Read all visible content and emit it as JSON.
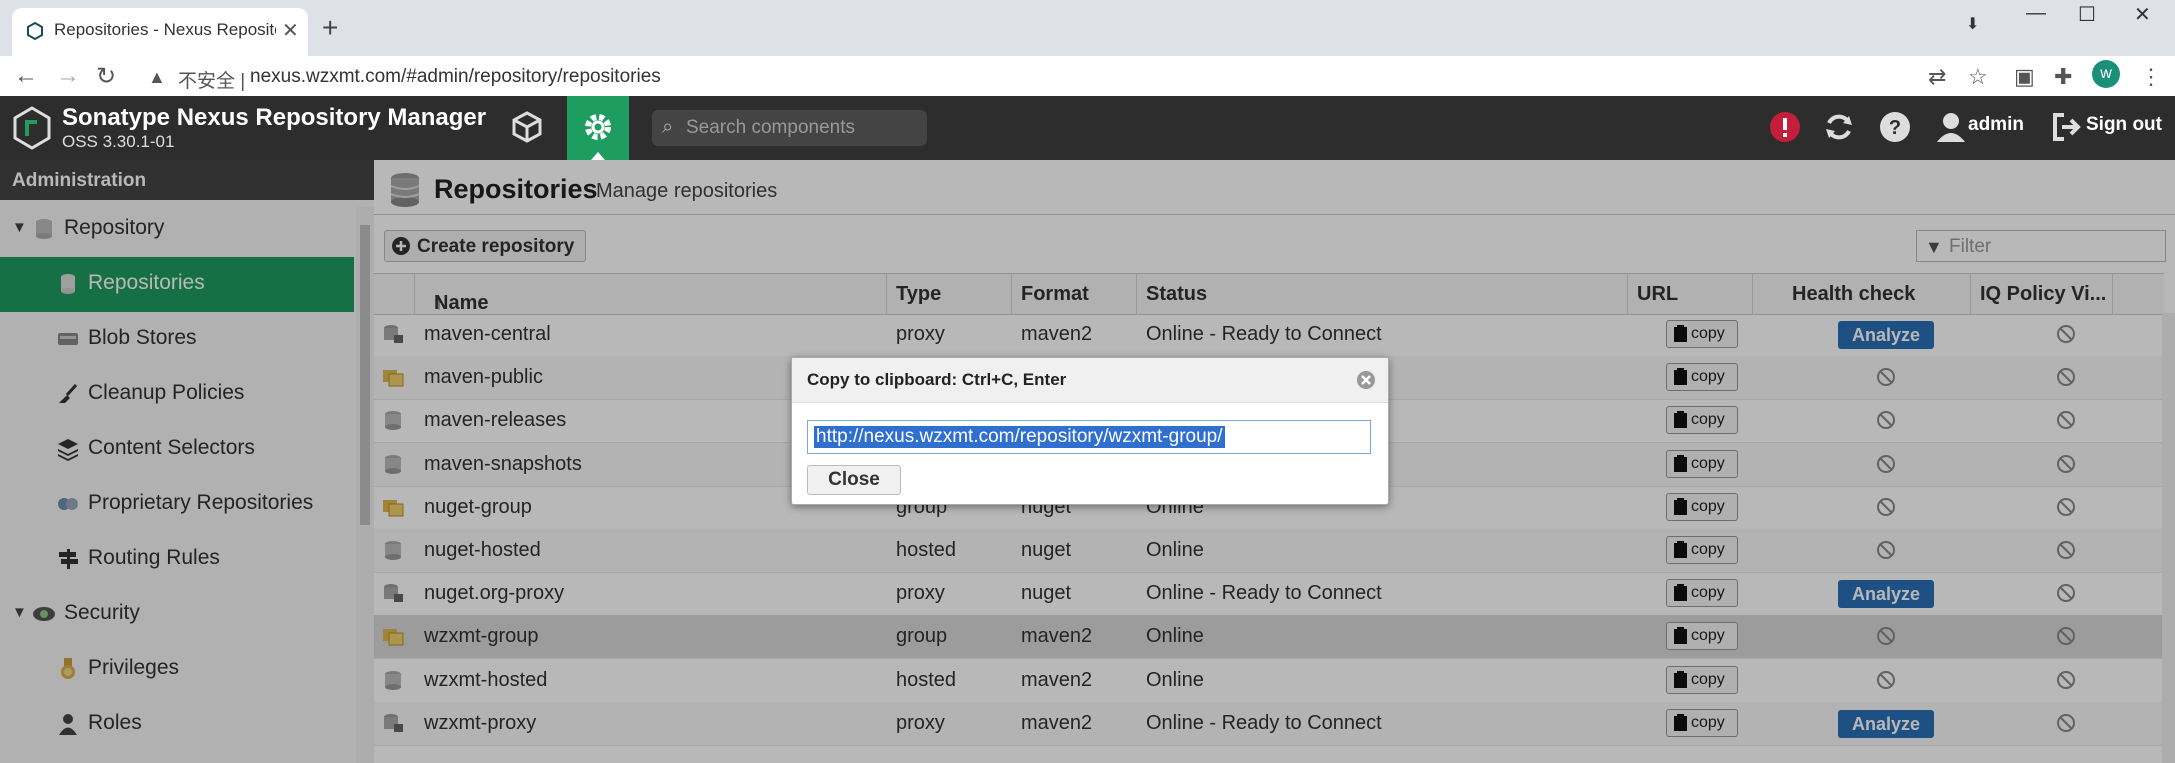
{
  "browser": {
    "tab_title": "Repositories - Nexus Repositor",
    "security_label": "不安全",
    "url": "nexus.wzxmt.com/#admin/repository/repositories",
    "profile_initial": "w"
  },
  "header": {
    "app_title": "Sonatype Nexus Repository Manager",
    "version": "OSS 3.30.1-01",
    "search_placeholder": "Search components",
    "user": "admin",
    "signout": "Sign out"
  },
  "sidebar": {
    "title": "Administration",
    "items": [
      {
        "label": "Repository",
        "icon": "database-icon"
      },
      {
        "label": "Repositories",
        "icon": "repositories-icon"
      },
      {
        "label": "Blob Stores",
        "icon": "blob-store-icon"
      },
      {
        "label": "Cleanup Policies",
        "icon": "broom-icon"
      },
      {
        "label": "Content Selectors",
        "icon": "layers-icon"
      },
      {
        "label": "Proprietary Repositories",
        "icon": "proprietary-icon"
      },
      {
        "label": "Routing Rules",
        "icon": "signpost-icon"
      },
      {
        "label": "Security",
        "icon": "security-icon"
      },
      {
        "label": "Privileges",
        "icon": "medal-icon"
      },
      {
        "label": "Roles",
        "icon": "role-icon"
      }
    ]
  },
  "main": {
    "title": "Repositories",
    "subtitle": "Manage repositories",
    "create_button": "Create repository",
    "filter_placeholder": "Filter",
    "columns": [
      "Name",
      "Type",
      "Format",
      "Status",
      "URL",
      "Health check",
      "IQ Policy Vi..."
    ],
    "sort_indicator": "↑",
    "copy_label": "copy",
    "analyze_label": "Analyze",
    "rows": [
      {
        "name": "maven-central",
        "type": "proxy",
        "format": "maven2",
        "status": "Online - Ready to Connect",
        "icon": "proxy-repo-icon",
        "analyze": true
      },
      {
        "name": "maven-public",
        "type": "",
        "format": "",
        "status": "",
        "icon": "group-repo-icon",
        "analyze": false
      },
      {
        "name": "maven-releases",
        "type": "",
        "format": "",
        "status": "",
        "icon": "hosted-repo-icon",
        "analyze": false
      },
      {
        "name": "maven-snapshots",
        "type": "",
        "format": "",
        "status": "",
        "icon": "hosted-repo-icon",
        "analyze": false
      },
      {
        "name": "nuget-group",
        "type": "group",
        "format": "nuget",
        "status": "Online",
        "icon": "group-repo-icon",
        "analyze": false
      },
      {
        "name": "nuget-hosted",
        "type": "hosted",
        "format": "nuget",
        "status": "Online",
        "icon": "hosted-repo-icon",
        "analyze": false
      },
      {
        "name": "nuget.org-proxy",
        "type": "proxy",
        "format": "nuget",
        "status": "Online - Ready to Connect",
        "icon": "proxy-repo-icon",
        "analyze": true
      },
      {
        "name": "wzxmt-group",
        "type": "group",
        "format": "maven2",
        "status": "Online",
        "icon": "group-repo-icon",
        "analyze": false
      },
      {
        "name": "wzxmt-hosted",
        "type": "hosted",
        "format": "maven2",
        "status": "Online",
        "icon": "hosted-repo-icon",
        "analyze": false
      },
      {
        "name": "wzxmt-proxy",
        "type": "proxy",
        "format": "maven2",
        "status": "Online - Ready to Connect",
        "icon": "proxy-repo-icon",
        "analyze": true
      }
    ]
  },
  "dialog": {
    "title": "Copy to clipboard: Ctrl+C, Enter",
    "value": "http://nexus.wzxmt.com/repository/wzxmt-group/",
    "close_label": "Close"
  },
  "colors": {
    "accent": "#1e9d60",
    "header_bg": "#2d2d2d",
    "analyze_bg": "#2c6fb8",
    "alert": "#c41e3a"
  }
}
